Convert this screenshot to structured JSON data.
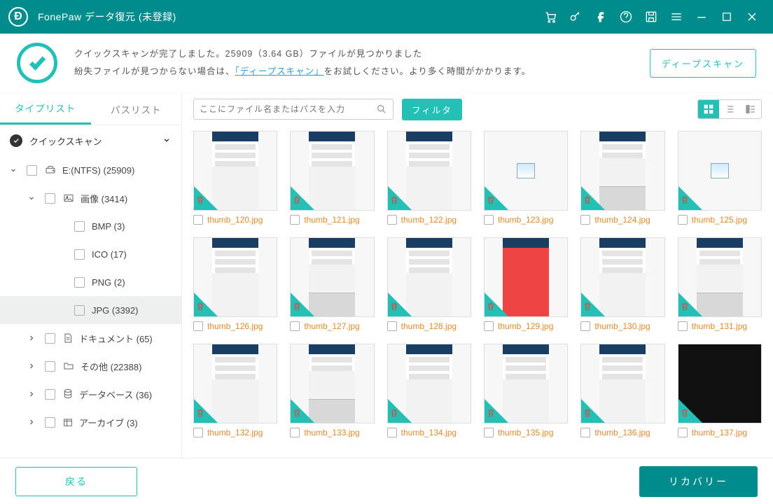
{
  "titlebar": {
    "app_name": "FonePaw データ復元 (未登録)"
  },
  "status": {
    "line1": "クイックスキャンが完了しました。25909（3.64 GB）ファイルが見つかりました",
    "line2_pre": "紛失ファイルが見つからない場合は、",
    "line2_link": "「ディープスキャン」",
    "line2_post": "をお試しください。より多く時間がかかります。",
    "deep_btn": "ディープスキャン"
  },
  "sidebar": {
    "tabs": {
      "type": "タイプリスト",
      "path": "パスリスト"
    },
    "section": "クイックスキャン",
    "nodes": [
      {
        "label": "E:(NTFS) (25909)",
        "level": 0,
        "arrow": "down",
        "icon": "drive"
      },
      {
        "label": "画像 (3414)",
        "level": 1,
        "arrow": "down",
        "icon": "image"
      },
      {
        "label": "BMP (3)",
        "level": 2
      },
      {
        "label": "ICO (17)",
        "level": 2
      },
      {
        "label": "PNG (2)",
        "level": 2
      },
      {
        "label": "JPG (3392)",
        "level": 2,
        "selected": true
      },
      {
        "label": "ドキュメント (65)",
        "level": 1,
        "arrow": "right",
        "icon": "doc"
      },
      {
        "label": "その他 (22388)",
        "level": 1,
        "arrow": "right",
        "icon": "folder"
      },
      {
        "label": "データベース (36)",
        "level": 1,
        "arrow": "right",
        "icon": "db"
      },
      {
        "label": "アーカイブ (3)",
        "level": 1,
        "arrow": "right",
        "icon": "archive"
      }
    ]
  },
  "toolbar": {
    "search_placeholder": "ここにファイル名またはパスを入力",
    "filter_label": "フィルタ"
  },
  "grid": {
    "items": [
      {
        "name": "thumb_120.jpg",
        "kind": "phone"
      },
      {
        "name": "thumb_121.jpg",
        "kind": "phone"
      },
      {
        "name": "thumb_122.jpg",
        "kind": "phone"
      },
      {
        "name": "thumb_123.jpg",
        "kind": "img"
      },
      {
        "name": "thumb_124.jpg",
        "kind": "kb"
      },
      {
        "name": "thumb_125.jpg",
        "kind": "img"
      },
      {
        "name": "thumb_126.jpg",
        "kind": "phone"
      },
      {
        "name": "thumb_127.jpg",
        "kind": "kb"
      },
      {
        "name": "thumb_128.jpg",
        "kind": "phone"
      },
      {
        "name": "thumb_129.jpg",
        "kind": "red"
      },
      {
        "name": "thumb_130.jpg",
        "kind": "phone"
      },
      {
        "name": "thumb_131.jpg",
        "kind": "kb"
      },
      {
        "name": "thumb_132.jpg",
        "kind": "phone"
      },
      {
        "name": "thumb_133.jpg",
        "kind": "kb"
      },
      {
        "name": "thumb_134.jpg",
        "kind": "phone"
      },
      {
        "name": "thumb_135.jpg",
        "kind": "phone"
      },
      {
        "name": "thumb_136.jpg",
        "kind": "phone"
      },
      {
        "name": "thumb_137.jpg",
        "kind": "dark"
      }
    ]
  },
  "footer": {
    "back": "戻る",
    "recover": "リカバリー"
  },
  "colors": {
    "brand": "#008c8c",
    "accent": "#24c0b6",
    "filename": "#e08a2e"
  }
}
